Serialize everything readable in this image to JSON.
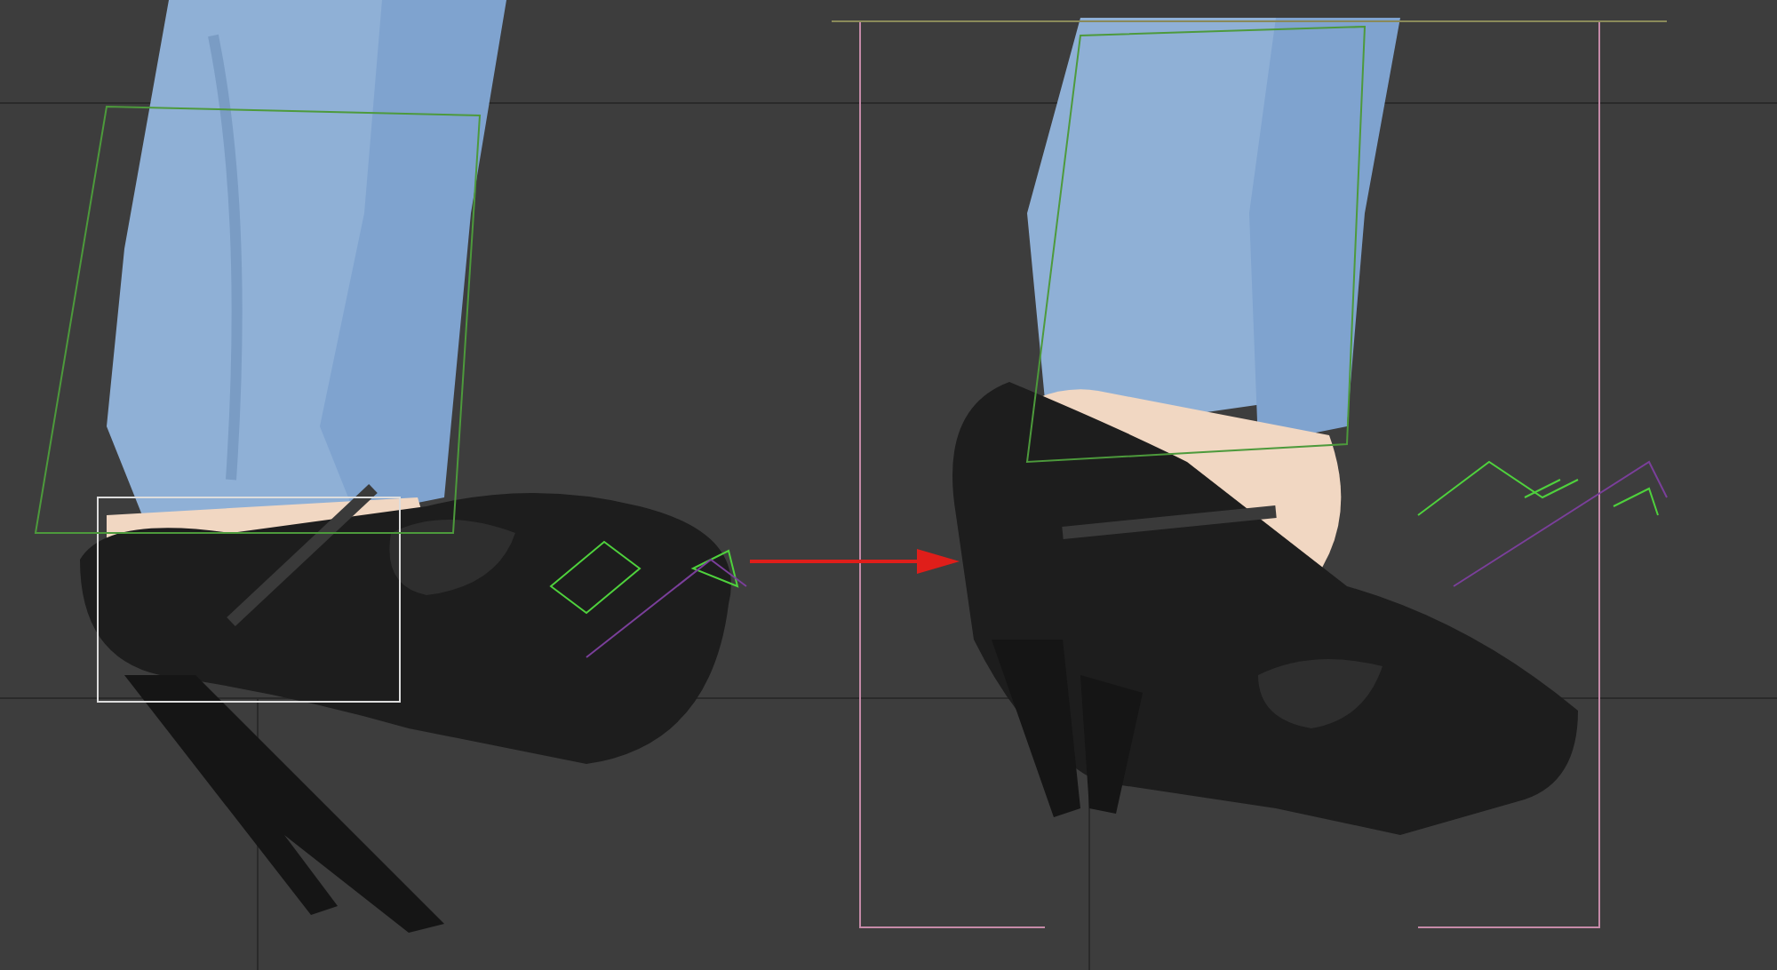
{
  "viewports": [
    {
      "kind": "before"
    },
    {
      "kind": "after"
    }
  ],
  "arrow": {
    "kind": "pointer"
  }
}
